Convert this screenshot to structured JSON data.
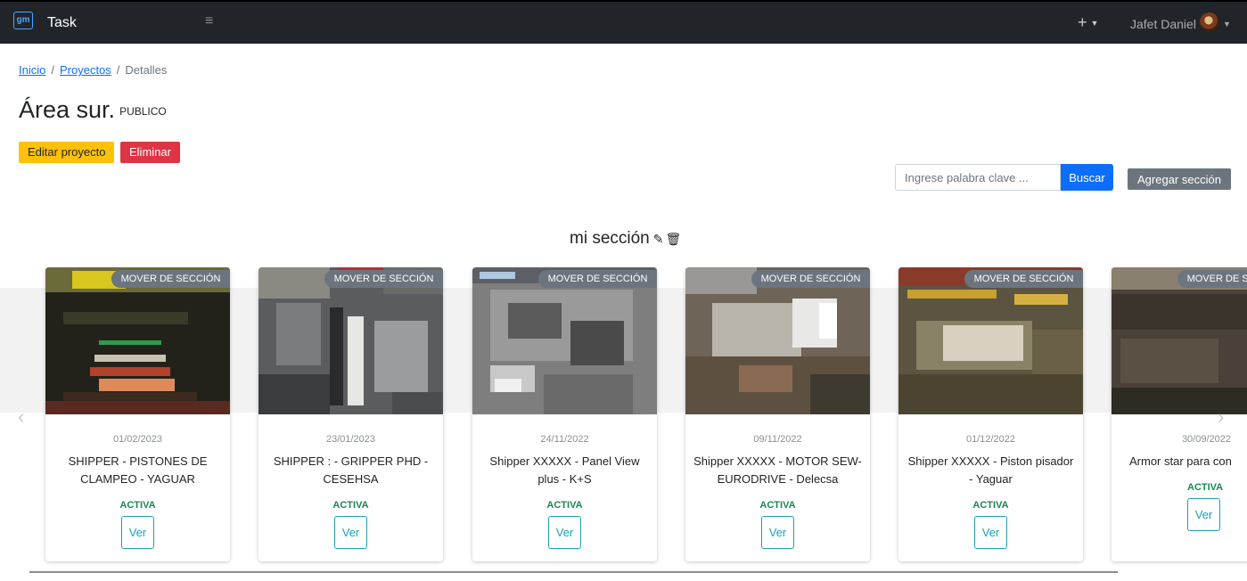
{
  "navbar": {
    "logo_text": "gm",
    "brand": "Task",
    "menu_icon": "≡",
    "plus_label": "+",
    "user_name": "Jafet Daniel"
  },
  "breadcrumb": {
    "home": "Inicio",
    "projects": "Proyectos",
    "current": "Detalles",
    "separator": "/"
  },
  "project": {
    "title": "Área sur.",
    "visibility": "PUBLICO",
    "edit_label": "Editar proyecto",
    "delete_label": "Eliminar"
  },
  "search": {
    "placeholder": "Ingrese palabra clave ...",
    "button_label": "Buscar"
  },
  "add_section_label": "Agregar sección",
  "section": {
    "title": "mi sección",
    "cards": [
      {
        "move_label": "MOVER DE SECCIÓN",
        "date": "01/02/2023",
        "title": "SHIPPER           - PISTONES DE CLAMPEO - YAGUAR",
        "status": "ACTIVA",
        "view_label": "Ver"
      },
      {
        "move_label": "MOVER DE SECCIÓN",
        "date": "23/01/2023",
        "title": "SHIPPER :          - GRIPPER PHD - CESEHSA",
        "status": "ACTIVA",
        "view_label": "Ver"
      },
      {
        "move_label": "MOVER DE SECCIÓN",
        "date": "24/11/2022",
        "title": "Shipper XXXXX - Panel View plus - K+S",
        "status": "ACTIVA",
        "view_label": "Ver"
      },
      {
        "move_label": "MOVER DE SECCIÓN",
        "date": "09/11/2022",
        "title": "Shipper XXXXX - MOTOR SEW-EURODRIVE - Delecsa",
        "status": "ACTIVA",
        "view_label": "Ver"
      },
      {
        "move_label": "MOVER DE SECCIÓN",
        "date": "01/12/2022",
        "title": "Shipper XXXXX - Piston pisador - Yaguar",
        "status": "ACTIVA",
        "view_label": "Ver"
      },
      {
        "move_label": "MOVER DE SECCIÓN",
        "date": "30/09/2022",
        "title": "Armor star para con",
        "status": "ACTIVA",
        "view_label": "Ver"
      }
    ]
  },
  "colors": {
    "navbar": "#212529",
    "edit": "#ffc107",
    "delete": "#dc3545",
    "primary": "#0d6efd",
    "secondary": "#6c757d",
    "active": "#198754",
    "outline_info": "#17a2b8"
  }
}
